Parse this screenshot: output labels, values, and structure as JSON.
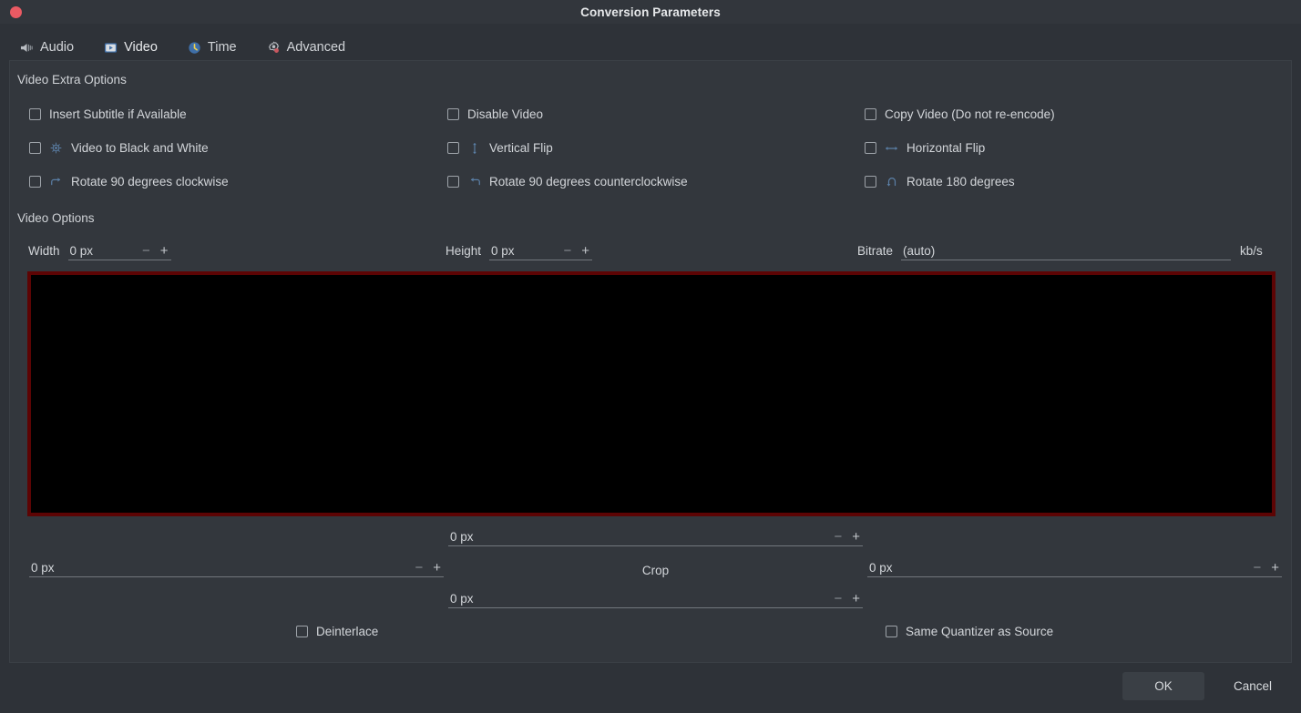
{
  "window": {
    "title": "Conversion Parameters",
    "close_icon": "close-dot-icon"
  },
  "tabs": [
    {
      "label": "Audio",
      "icon": "speaker-icon",
      "active": false
    },
    {
      "label": "Video",
      "icon": "video-monitor-icon",
      "active": true
    },
    {
      "label": "Time",
      "icon": "clock-icon",
      "active": false
    },
    {
      "label": "Advanced",
      "icon": "gear-icon",
      "active": false
    }
  ],
  "video_extra_options": {
    "group_label": "Video Extra Options",
    "items": [
      {
        "label": "Insert Subtitle if Available",
        "checked": false,
        "icon": null
      },
      {
        "label": "Video to Black and White",
        "checked": false,
        "icon": "contrast-icon"
      },
      {
        "label": "Rotate 90 degrees clockwise",
        "checked": false,
        "icon": "rotate-cw-icon"
      },
      {
        "label": "Disable Video",
        "checked": false,
        "icon": null
      },
      {
        "label": "Vertical Flip",
        "checked": false,
        "icon": "vertical-flip-icon"
      },
      {
        "label": "Rotate 90 degrees counterclockwise",
        "checked": false,
        "icon": "rotate-ccw-icon"
      },
      {
        "label": "Copy Video (Do not re-encode)",
        "checked": false,
        "icon": null
      },
      {
        "label": "Horizontal Flip",
        "checked": false,
        "icon": "horizontal-flip-icon"
      },
      {
        "label": "Rotate 180 degrees",
        "checked": false,
        "icon": "rotate-180-icon"
      }
    ]
  },
  "video_options": {
    "group_label": "Video Options",
    "width": {
      "label": "Width",
      "value": "0 px",
      "minus": "−",
      "plus": "+"
    },
    "height": {
      "label": "Height",
      "value": "0 px",
      "minus": "−",
      "plus": "+"
    },
    "bitrate": {
      "label": "Bitrate",
      "value": "(auto)",
      "placeholder": "(auto)",
      "suffix": "kb/s"
    }
  },
  "crop": {
    "caption": "Crop",
    "top": {
      "value": "0 px",
      "minus": "−",
      "plus": "+"
    },
    "bottom": {
      "value": "0 px",
      "minus": "−",
      "plus": "+"
    },
    "left": {
      "value": "0 px",
      "minus": "−",
      "plus": "+"
    },
    "right": {
      "value": "0 px",
      "minus": "−",
      "plus": "+"
    },
    "preview_color": "#000000",
    "border_color": "#5d0404"
  },
  "bottom_options": {
    "deinterlace": {
      "label": "Deinterlace",
      "checked": false
    },
    "same_quantizer": {
      "label": "Same Quantizer as Source",
      "checked": false
    }
  },
  "footer": {
    "ok_label": "OK",
    "cancel_label": "Cancel"
  },
  "colors": {
    "accent": "#2fc6a0",
    "icon_blue": "#5b7fa6",
    "window_bg": "#2e3238",
    "panel_bg": "#33373d",
    "titlebar_bg": "#32363c",
    "close_dot": "#ea5a63"
  }
}
